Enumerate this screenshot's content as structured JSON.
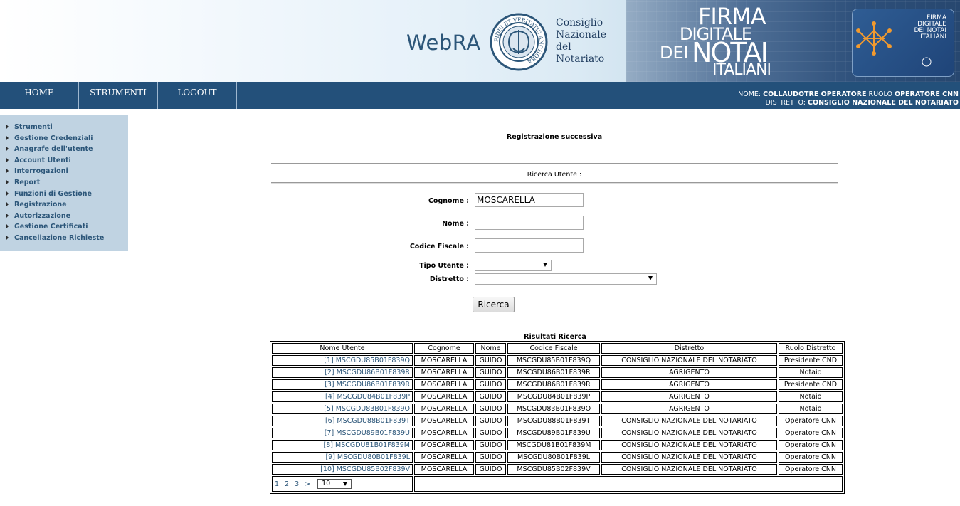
{
  "header": {
    "app_title": "WebRA",
    "cnn_name_lines": [
      "Consiglio",
      "Nazionale",
      "del",
      "Notariato"
    ],
    "seal_text": "FIDEI ET VERITATIS ANCHORA",
    "firma_logo": {
      "l1": "FIRMA",
      "l2": "DIGITALE",
      "l3a": "DEI",
      "l3b": "NOTAI",
      "l4": "ITALIANI"
    },
    "card_text": {
      "l1": "FIRMA",
      "l2": "DIGITALE",
      "l3": "DEI NOTAI",
      "l4": "ITALIANI"
    }
  },
  "nav": {
    "home": "HOME",
    "tools": "STRUMENTI",
    "logout": "LOGOUT"
  },
  "userinfo": {
    "name_label": "NOME:",
    "name_value": "COLLAUDOTRE OPERATORE",
    "role_label": "RUOLO",
    "role_value": "OPERATORE CNN",
    "district_label": "DISTRETTO:",
    "district_value": "CONSIGLIO NAZIONALE DEL NOTARIATO"
  },
  "sidebar": {
    "items": [
      "Strumenti",
      "Gestione Credenziali",
      "Anagrafe dell'utente",
      "Account Utenti",
      "Interrogazioni",
      "Report",
      "Funzioni di Gestione",
      "Registrazione",
      "Autorizzazione",
      "Gestione Certificati",
      "Cancellazione Richieste"
    ]
  },
  "main": {
    "page_title": "Registrazione successiva",
    "search_title": "Ricerca Utente :",
    "form": {
      "cognome_label": "Cognome :",
      "cognome_value": "MOSCARELLA",
      "nome_label": "Nome :",
      "nome_value": "",
      "cf_label": "Codice Fiscale :",
      "cf_value": "",
      "tipo_label": "Tipo Utente :",
      "tipo_value": "",
      "distretto_label": "Distretto :",
      "distretto_value": "",
      "search_button": "Ricerca"
    },
    "results": {
      "title": "Risultati Ricerca",
      "columns": [
        "Nome Utente",
        "Cognome",
        "Nome",
        "Codice Fiscale",
        "Distretto",
        "Ruolo Distretto"
      ],
      "rows": [
        [
          "[1] MSCGDU85B01F839Q",
          "MOSCARELLA",
          "GUIDO",
          "MSCGDU85B01F839Q",
          "CONSIGLIO NAZIONALE DEL NOTARIATO",
          "Presidente CND"
        ],
        [
          "[2] MSCGDU86B01F839R",
          "MOSCARELLA",
          "GUIDO",
          "MSCGDU86B01F839R",
          "AGRIGENTO",
          "Notaio"
        ],
        [
          "[3] MSCGDU86B01F839R",
          "MOSCARELLA",
          "GUIDO",
          "MSCGDU86B01F839R",
          "AGRIGENTO",
          "Presidente CND"
        ],
        [
          "[4] MSCGDU84B01F839P",
          "MOSCARELLA",
          "GUIDO",
          "MSCGDU84B01F839P",
          "AGRIGENTO",
          "Notaio"
        ],
        [
          "[5] MSCGDU83B01F839O",
          "MOSCARELLA",
          "GUIDO",
          "MSCGDU83B01F839O",
          "AGRIGENTO",
          "Notaio"
        ],
        [
          "[6] MSCGDU88B01F839T",
          "MOSCARELLA",
          "GUIDO",
          "MSCGDU88B01F839T",
          "CONSIGLIO NAZIONALE DEL NOTARIATO",
          "Operatore CNN"
        ],
        [
          "[7] MSCGDU89B01F839U",
          "MOSCARELLA",
          "GUIDO",
          "MSCGDU89B01F839U",
          "CONSIGLIO NAZIONALE DEL NOTARIATO",
          "Operatore CNN"
        ],
        [
          "[8] MSCGDU81B01F839M",
          "MOSCARELLA",
          "GUIDO",
          "MSCGDU81B01F839M",
          "CONSIGLIO NAZIONALE DEL NOTARIATO",
          "Operatore CNN"
        ],
        [
          "[9] MSCGDU80B01F839L",
          "MOSCARELLA",
          "GUIDO",
          "MSCGDU80B01F839L",
          "CONSIGLIO NAZIONALE DEL NOTARIATO",
          "Operatore CNN"
        ],
        [
          "[10] MSCGDU85B02F839V",
          "MOSCARELLA",
          "GUIDO",
          "MSCGDU85B02F839V",
          "CONSIGLIO NAZIONALE DEL NOTARIATO",
          "Operatore CNN"
        ]
      ],
      "pages": [
        "1",
        "2",
        "3",
        ">"
      ],
      "page_size": "10"
    }
  },
  "colors": {
    "nav_bg": "#23507a",
    "sidebar_bg": "#c0d3e2",
    "link": "#2c5679"
  }
}
